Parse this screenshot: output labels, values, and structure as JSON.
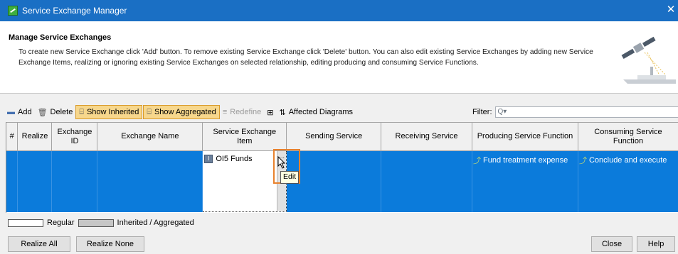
{
  "window": {
    "title": "Service Exchange Manager",
    "close_glyph": "✕",
    "icon": "app-icon"
  },
  "header": {
    "title": "Manage Service Exchanges",
    "description": "To create new Service Exchange click 'Add' button. To remove existing Service Exchange click 'Delete' button. You can also edit existing Service Exchanges by adding new Service Exchange Items, realizing or ignoring existing Service Exchanges on selected relationship, editing producing and consuming Service Functions."
  },
  "toolbar": {
    "add_label": "Add",
    "delete_label": "Delete",
    "show_inherited_label": "Show Inherited",
    "show_aggregated_label": "Show Aggregated",
    "redefine_label": "Redefine",
    "affected_diagrams_label": "Affected Diagrams",
    "filter_label": "Filter:",
    "filter_placeholder": "Q▾",
    "toggled_color": "#f7d78c"
  },
  "table": {
    "columns": [
      "#",
      "Realize",
      "Exchange ID",
      "Exchange Name",
      "Service Exchange Item",
      "Sending Service",
      "Receiving Service",
      "Producing Service Function",
      "Consuming Service Function"
    ],
    "row": {
      "number": "",
      "realize": "",
      "exchange_id": "",
      "exchange_name": "",
      "item": "OI5 Funds",
      "item_icon": "I",
      "sending_service": "",
      "receiving_service": "",
      "producing_function": "Fund treatment expense",
      "consuming_function": "Conclude and execute"
    },
    "selected_row_color": "#0b7bdb",
    "edit_button_glyph": "...",
    "tooltip": "Edit"
  },
  "legend": {
    "regular_label": "Regular",
    "inherited_label": "Inherited / Aggregated"
  },
  "buttons": {
    "realize_all": "Realize All",
    "realize_none": "Realize None",
    "close": "Close",
    "help": "Help"
  }
}
